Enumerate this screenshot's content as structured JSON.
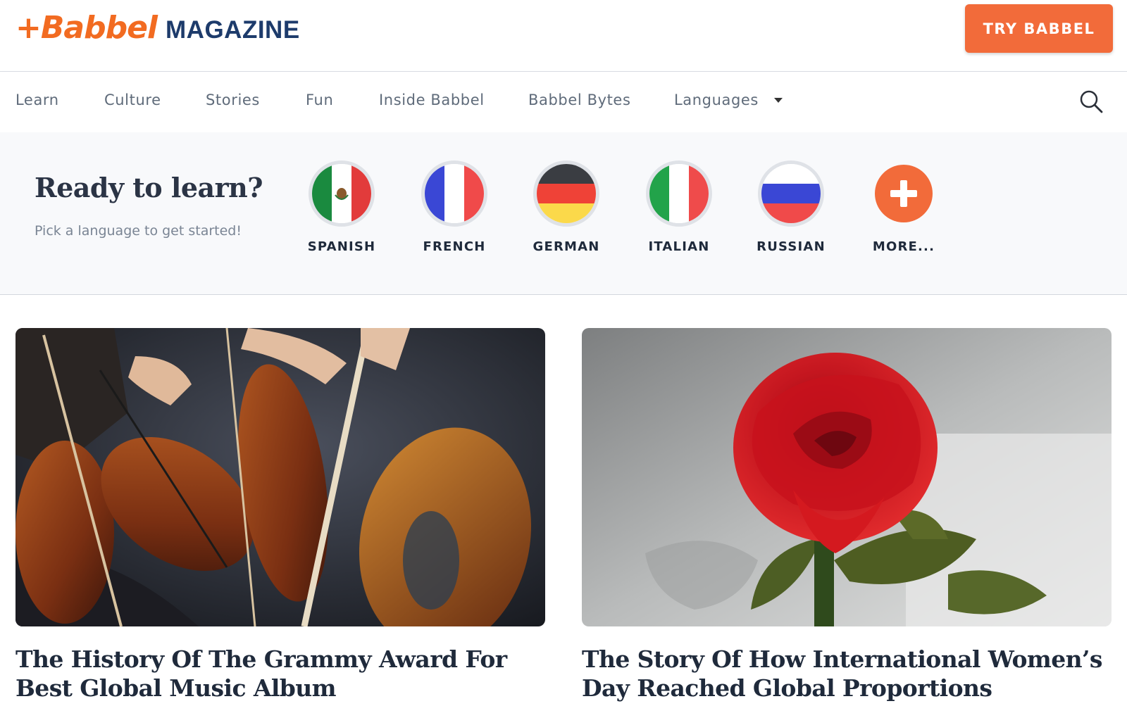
{
  "header": {
    "logo_brand": "+Babbel",
    "logo_section": "MAGAZINE",
    "cta_label": "TRY BABBEL"
  },
  "nav": {
    "items": [
      "Learn",
      "Culture",
      "Stories",
      "Fun",
      "Inside Babbel",
      "Babbel Bytes",
      "Languages"
    ]
  },
  "picker": {
    "title": "Ready to learn?",
    "subtitle": "Pick a language to get started!",
    "languages": [
      {
        "label": "SPANISH",
        "flag": "mexico-flag-icon"
      },
      {
        "label": "FRENCH",
        "flag": "france-flag-icon"
      },
      {
        "label": "GERMAN",
        "flag": "germany-flag-icon"
      },
      {
        "label": "ITALIAN",
        "flag": "italy-flag-icon"
      },
      {
        "label": "RUSSIAN",
        "flag": "russia-flag-icon"
      },
      {
        "label": "MORE...",
        "flag": "plus-icon"
      }
    ]
  },
  "articles": [
    {
      "title": "The History Of The Grammy Award For Best Global Music Album",
      "image": "violins-image"
    },
    {
      "title": "The Story Of How International Women’s Day Reached Global Proportions",
      "image": "red-rose-image"
    }
  ],
  "colors": {
    "brand_orange": "#f26b3a",
    "brand_navy": "#1d3b6b"
  }
}
